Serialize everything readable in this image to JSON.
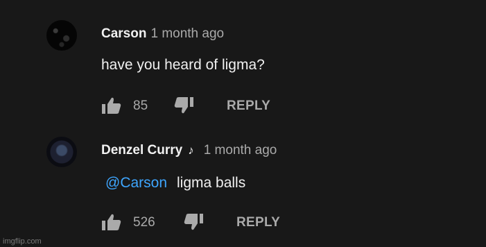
{
  "comments": [
    {
      "author": "Carson",
      "time": "1 month ago",
      "text": "have you heard of ligma?",
      "likes": "85",
      "reply_label": "REPLY",
      "avatar_icon": "dark-speckled-avatar"
    },
    {
      "author": "Denzel Curry",
      "author_badge_icon": "music-note-icon",
      "author_badge": "♪",
      "time": "1 month ago",
      "mention": "@Carson",
      "text": "ligma balls",
      "likes": "526",
      "reply_label": "REPLY",
      "avatar_icon": "dark-portrait-avatar"
    }
  ],
  "colors": {
    "background": "#181818",
    "primary_text": "#f1f1f1",
    "secondary_text": "#aaaaaa",
    "mention": "#3ea6ff"
  },
  "watermark": "imgflip.com"
}
